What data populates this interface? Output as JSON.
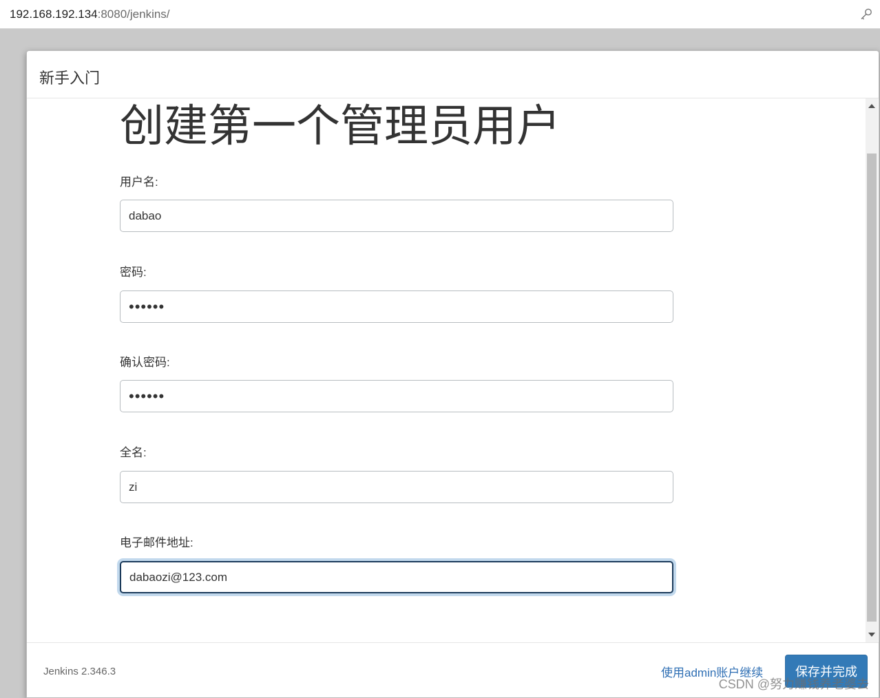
{
  "browser": {
    "url_host": "192.168.192.134",
    "url_path": ":8080/jenkins/",
    "key_icon": "key-icon"
  },
  "dialog": {
    "title": "新手入门",
    "heading": "创建第一个管理员用户",
    "fields": [
      {
        "label": "用户名:",
        "value": "dabao",
        "type": "text"
      },
      {
        "label": "密码:",
        "value": "••••••",
        "type": "password"
      },
      {
        "label": "确认密码:",
        "value": "••••••",
        "type": "password"
      },
      {
        "label": "全名:",
        "value": "zi",
        "type": "text"
      },
      {
        "label": "电子邮件地址:",
        "value": "dabaozi@123.com",
        "type": "text",
        "focused": true
      }
    ]
  },
  "footer": {
    "version": "Jenkins 2.346.3",
    "continue_link": "使用admin账户继续",
    "save_button": "保存并完成"
  },
  "watermark": "CSDN @努力赚钱养老婆去",
  "colors": {
    "primary_button": "#337ab7",
    "link": "#2f6fb4",
    "focus_ring": "#c2d9ed"
  }
}
